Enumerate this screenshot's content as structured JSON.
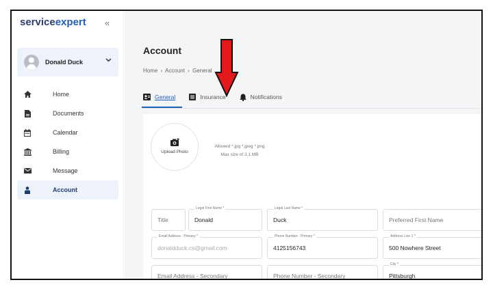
{
  "app": {
    "logo_part1": "service",
    "logo_part2": "expert",
    "collapse_glyph": "«"
  },
  "user": {
    "name": "Donald Duck"
  },
  "sidebar": {
    "items": [
      {
        "label": "Home",
        "icon": "home-icon"
      },
      {
        "label": "Documents",
        "icon": "document-icon"
      },
      {
        "label": "Calendar",
        "icon": "calendar-icon"
      },
      {
        "label": "Billing",
        "icon": "bank-icon"
      },
      {
        "label": "Message",
        "icon": "envelope-icon"
      },
      {
        "label": "Account",
        "icon": "person-icon",
        "active": true
      }
    ]
  },
  "page": {
    "title": "Account",
    "breadcrumb": [
      "Home",
      "›",
      "Account",
      "›",
      "General"
    ]
  },
  "tabs": [
    {
      "label": "General",
      "icon": "id-card-icon",
      "active": true
    },
    {
      "label": "Insurance",
      "icon": "list-icon"
    },
    {
      "label": "Notifications",
      "icon": "bell-icon"
    }
  ],
  "photo": {
    "label": "Upload Photo",
    "hint_line1": "Allowed *.jpg *.jpeg *.png",
    "hint_line2": "Max size of 3.1 MB"
  },
  "form": {
    "title": {
      "label": "",
      "value": "",
      "placeholder": "Title"
    },
    "first_name": {
      "label": "Legal First Name *",
      "value": "Donald",
      "placeholder": ""
    },
    "last_name": {
      "label": "Legal Last Name *",
      "value": "Duck",
      "placeholder": ""
    },
    "preferred_first": {
      "label": "",
      "value": "",
      "placeholder": "Preferred First Name"
    },
    "email_primary": {
      "label": "Email Address - Primary *",
      "value": "donaldduck.cs@gmail.com",
      "placeholder": ""
    },
    "phone_primary": {
      "label": "Phone Number - Primary *",
      "value": "4125156743",
      "placeholder": ""
    },
    "address1": {
      "label": "Address Line 1 *",
      "value": "500 Nowhere Street",
      "placeholder": ""
    },
    "email_secondary": {
      "label": "",
      "value": "",
      "placeholder": "Email Address - Secondary"
    },
    "phone_secondary": {
      "label": "",
      "value": "",
      "placeholder": "Phone Number - Secondary"
    },
    "city": {
      "label": "City *",
      "value": "Pittsburgh",
      "placeholder": ""
    }
  },
  "colors": {
    "accent": "#1f5fb8",
    "annotation_arrow": "#e3191c"
  }
}
